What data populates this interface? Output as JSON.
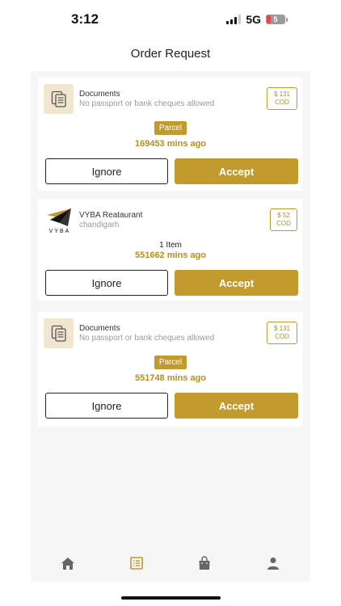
{
  "status_bar": {
    "time": "3:12",
    "network": "5G",
    "battery": "5"
  },
  "header": {
    "title": "Order Request"
  },
  "orders": [
    {
      "type": "documents",
      "title": "Documents",
      "subtitle": "No passport or bank cheques allowed",
      "price": "$ 131",
      "payment": "COD",
      "tag": "Parcel",
      "time": "169453 mins ago",
      "ignore_label": "Ignore",
      "accept_label": "Accept"
    },
    {
      "type": "restaurant",
      "title": "VYBA Reataurant",
      "subtitle": "chandigarh",
      "logo_text": "VYBA",
      "price": "$ 52",
      "payment": "COD",
      "items": "1 Item",
      "time": "551662 mins ago",
      "ignore_label": "Ignore",
      "accept_label": "Accept"
    },
    {
      "type": "documents",
      "title": "Documents",
      "subtitle": "No passport or bank cheques allowed",
      "price": "$ 131",
      "payment": "COD",
      "tag": "Parcel",
      "time": "551748 mins ago",
      "ignore_label": "Ignore",
      "accept_label": "Accept"
    }
  ],
  "nav": [
    {
      "icon": "home-icon",
      "active": false
    },
    {
      "icon": "orders-list-icon",
      "active": true
    },
    {
      "icon": "shopping-bag-icon",
      "active": false
    },
    {
      "icon": "profile-icon",
      "active": false
    }
  ],
  "colors": {
    "accent": "#c39a2c",
    "accent_text": "#b58e2a",
    "thumb_bg": "#f1e6cf",
    "nav_active": "#c39a2c",
    "nav_inactive": "#666666"
  }
}
